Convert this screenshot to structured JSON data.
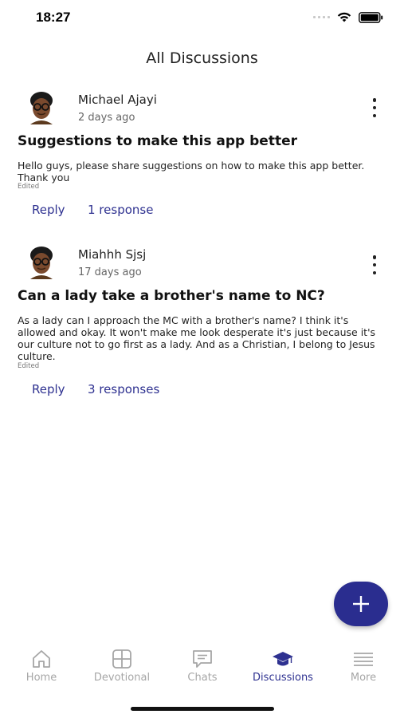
{
  "status_bar": {
    "time": "18:27"
  },
  "header": {
    "title": "All Discussions"
  },
  "posts": [
    {
      "author": "Michael Ajayi",
      "time_ago": "2 days ago",
      "title": "Suggestions to make this app better",
      "body": "Hello guys, please share suggestions on how to make this app better. Thank you",
      "edited": "Edited",
      "reply_label": "Reply",
      "responses_label": "1 response"
    },
    {
      "author": "Miahhh Sjsj",
      "time_ago": "17 days ago",
      "title": "Can a lady take a brother's name to NC?",
      "body": "As a lady can I approach the MC with a brother's name? I think it's allowed and okay. It won't make me look desperate it's just because it's our culture not to go first as a lady. And as a Christian, I belong to Jesus culture.",
      "edited": "Edited",
      "reply_label": "Reply",
      "responses_label": "3 responses"
    }
  ],
  "fab": {
    "icon": "plus-icon"
  },
  "tabbar": {
    "items": [
      {
        "label": "Home",
        "icon": "home-icon",
        "active": false
      },
      {
        "label": "Devotional",
        "icon": "grid-icon",
        "active": false
      },
      {
        "label": "Chats",
        "icon": "chat-icon",
        "active": false
      },
      {
        "label": "Discussions",
        "icon": "graduation-cap-icon",
        "active": true
      },
      {
        "label": "More",
        "icon": "menu-lines-icon",
        "active": false
      }
    ]
  },
  "colors": {
    "accent": "#2e3190",
    "fab": "#2a2d8f",
    "inactive": "#a6a6a6"
  }
}
